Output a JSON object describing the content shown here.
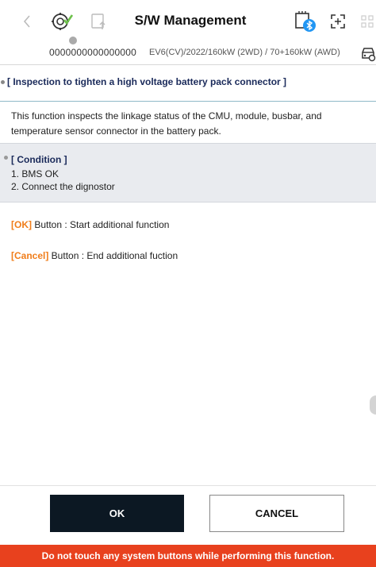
{
  "header": {
    "title": "S/W Management"
  },
  "vehicle_bar": {
    "vin": "0000000000000000",
    "vehicle": "EV6(CV)/2022/160kW (2WD) / 70+160kW (AWD)"
  },
  "content": {
    "section_title": "[ Inspection to tighten a high voltage battery pack connector ]",
    "description": "This function inspects the linkage status of the CMU, module, busbar, and temperature sensor connector in the battery pack.",
    "condition": {
      "title": "[ Condition ]",
      "items": [
        "1. BMS OK",
        "2. Connect the dignostor"
      ]
    },
    "notes": [
      {
        "key": "[OK]",
        "text": " Button : Start additional function"
      },
      {
        "key": "[Cancel]",
        "text": " Button : End additional fuction"
      }
    ]
  },
  "footer": {
    "ok_label": "OK",
    "cancel_label": "CANCEL",
    "warning": "Do not touch any system buttons while performing this function."
  },
  "icons": {
    "back": "chevron-left-icon",
    "diagnosis": "diagnosis-check-icon",
    "upload": "upload-icon",
    "bluetooth_vci": "vci-bluetooth-icon",
    "expand": "expand-icon",
    "grid": "grid-icon",
    "car": "car-icon"
  },
  "colors": {
    "accent_orange": "#f07d1a",
    "warning_red": "#e8411e",
    "ok_button": "#0c1823",
    "bluetooth_blue": "#2196f3",
    "check_green": "#6cc04a",
    "heading_navy": "#1a2a5a"
  }
}
